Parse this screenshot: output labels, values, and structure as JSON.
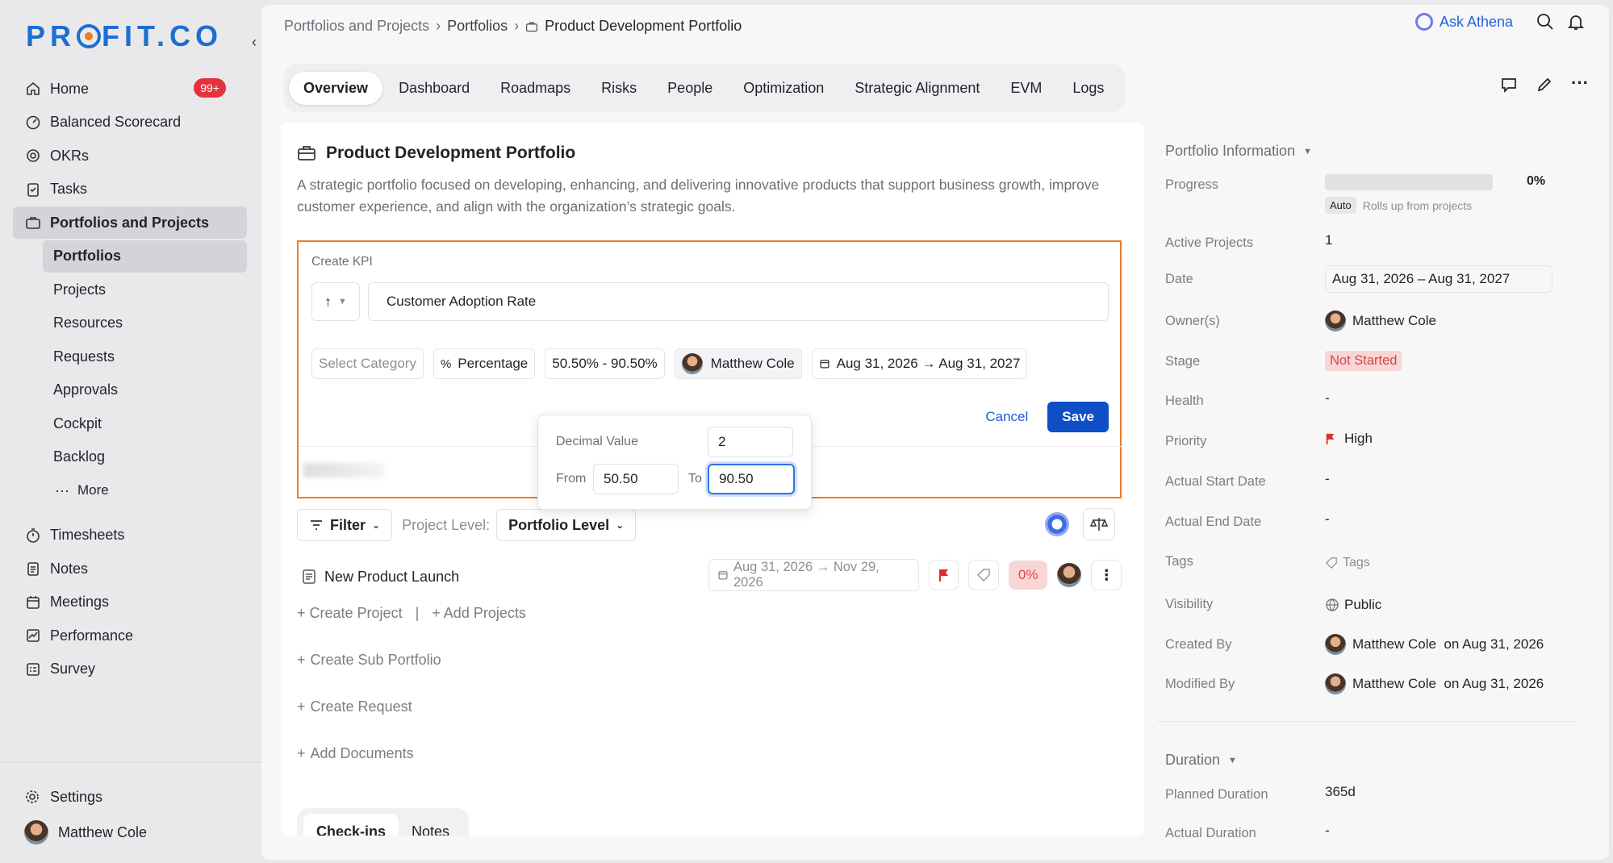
{
  "brand": {
    "logo_text_a": "PR",
    "logo_text_b": "FIT.CO"
  },
  "sidebar": {
    "items": [
      {
        "label": "Home",
        "badge": "99+",
        "icon": "home-icon"
      },
      {
        "label": "Balanced Scorecard",
        "icon": "scorecard-icon"
      },
      {
        "label": "OKRs",
        "icon": "target-icon"
      },
      {
        "label": "Tasks",
        "icon": "tasks-icon"
      },
      {
        "label": "Portfolios and Projects",
        "icon": "briefcase-icon"
      }
    ],
    "sub_items": [
      "Portfolios",
      "Projects",
      "Resources",
      "Requests",
      "Approvals",
      "Cockpit",
      "Backlog"
    ],
    "more_label": "More",
    "items2": [
      {
        "label": "Timesheets",
        "icon": "stopwatch-icon"
      },
      {
        "label": "Notes",
        "icon": "notes-icon"
      },
      {
        "label": "Meetings",
        "icon": "calendar-icon"
      },
      {
        "label": "Performance",
        "icon": "chart-icon"
      },
      {
        "label": "Survey",
        "icon": "survey-icon"
      }
    ],
    "settings_label": "Settings",
    "user_name": "Matthew Cole"
  },
  "breadcrumb": [
    "Portfolios and Projects",
    "Portfolios",
    "Product Development Portfolio"
  ],
  "header": {
    "ask_label": "Ask Athena"
  },
  "tabs": [
    "Overview",
    "Dashboard",
    "Roadmaps",
    "Risks",
    "People",
    "Optimization",
    "Strategic Alignment",
    "EVM",
    "Logs"
  ],
  "portfolio": {
    "title": "Product Development Portfolio",
    "description": "A strategic portfolio focused on developing, enhancing, and delivering innovative products that support business growth, improve customer experience, and align with the organization’s strategic goals."
  },
  "kpi_form": {
    "label": "Create KPI",
    "direction": "↑",
    "name_value": "Customer Adoption Rate",
    "category_placeholder": "Select Category",
    "unit": "Percentage",
    "unit_symbol": "%",
    "range": "50.50% - 90.50%",
    "owner": "Matthew Cole",
    "dates": "Aug 31, 2026 → Aug 31, 2027",
    "cancel_label": "Cancel",
    "save_label": "Save",
    "popup": {
      "decimal_label": "Decimal Value",
      "decimal_value": "2",
      "from_label": "From",
      "from_value": "50.50",
      "to_label": "To",
      "to_value": "90.50"
    }
  },
  "filter": {
    "filter_label": "Filter",
    "level_label": "Project Level:",
    "level_value": "Portfolio Level"
  },
  "project": {
    "name": "New Product Launch",
    "dates": "Aug 31, 2026 → Nov 29, 2026",
    "percent": "0%"
  },
  "actions": {
    "create_project": "Create Project",
    "divider": "|",
    "add_projects": "Add Projects",
    "create_sub_portfolio": "Create Sub Portfolio",
    "create_request": "Create Request",
    "add_documents": "Add Documents"
  },
  "bottom_tabs": [
    "Check-ins",
    "Notes"
  ],
  "info": {
    "header": "Portfolio Information",
    "progress_label": "Progress",
    "progress_value": "0%",
    "progress_fraction": 0,
    "auto_chip": "Auto",
    "rolls_up": "Rolls up from projects",
    "active_projects_label": "Active Projects",
    "active_projects": "1",
    "date_label": "Date",
    "date_value": "Aug 31, 2026 – Aug 31, 2027",
    "owners_label": "Owner(s)",
    "owner": "Matthew Cole",
    "stage_label": "Stage",
    "stage_value": "Not Started",
    "health_label": "Health",
    "health_value": "-",
    "priority_label": "Priority",
    "priority_value": "High",
    "actual_start_label": "Actual Start Date",
    "actual_start": "-",
    "actual_end_label": "Actual End Date",
    "actual_end": "-",
    "tags_label": "Tags",
    "tags_placeholder": "Tags",
    "visibility_label": "Visibility",
    "visibility_value": "Public",
    "created_by_label": "Created By",
    "created_by": "Matthew Cole",
    "created_on": "on Aug 31, 2026",
    "modified_by_label": "Modified By",
    "modified_by": "Matthew Cole",
    "modified_on": "on Aug 31, 2026",
    "duration_header": "Duration",
    "planned_label": "Planned Duration",
    "planned_value": "365d",
    "actual_label": "Actual Duration",
    "actual_value": "-"
  },
  "colors": {
    "accent": "#1c6fd1",
    "highlight": "#f07b22",
    "badge": "#e5323d",
    "save": "#0e4fc7"
  }
}
